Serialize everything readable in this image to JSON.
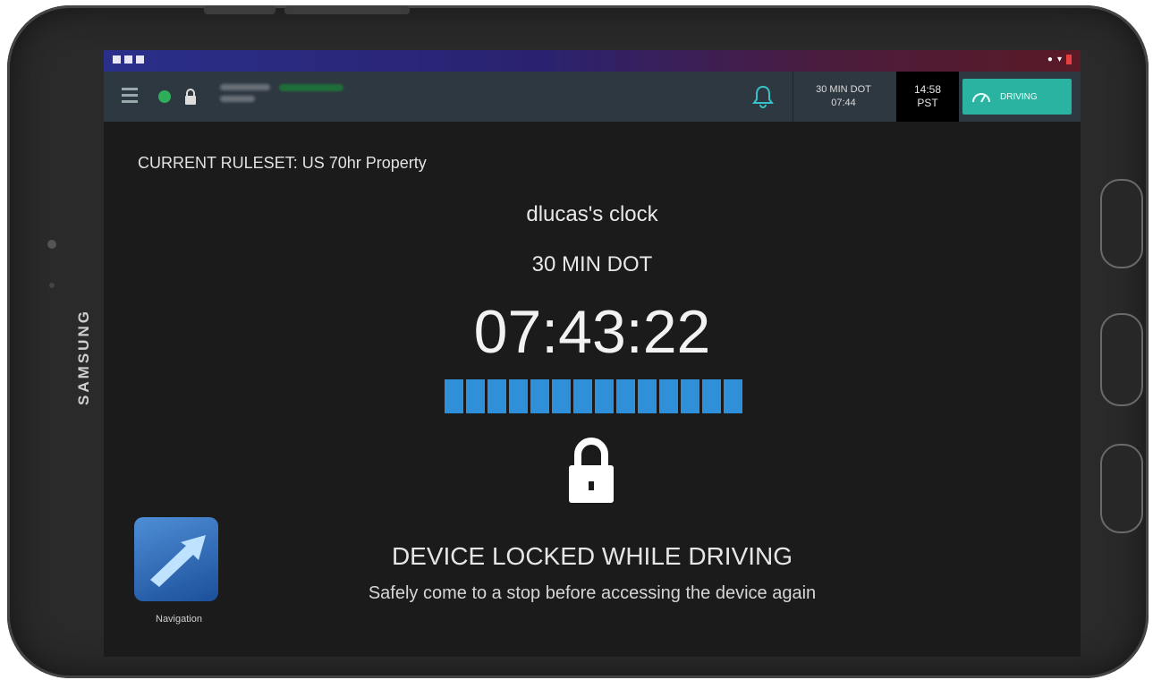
{
  "device": {
    "brand": "SAMSUNG"
  },
  "appbar": {
    "dot_line1": "30 MIN DOT",
    "dot_line2": "07:44",
    "time_line1": "14:58",
    "time_line2": "PST",
    "drive_label": "DRIVING"
  },
  "main": {
    "ruleset": "CURRENT RULESET:  US 70hr Property",
    "clock_title": "dlucas's clock",
    "dot_label": "30 MIN DOT",
    "timer": "07:43:22",
    "progress_segments": 14,
    "progress_color": "#2f8fd8",
    "locked_title": "DEVICE LOCKED WHILE DRIVING",
    "locked_subtitle": "Safely come to a stop before accessing the device again"
  },
  "apps": {
    "navigation_label": "Navigation"
  },
  "colors": {
    "accent": "#2bb3a2",
    "status_online": "#2fae5a"
  }
}
